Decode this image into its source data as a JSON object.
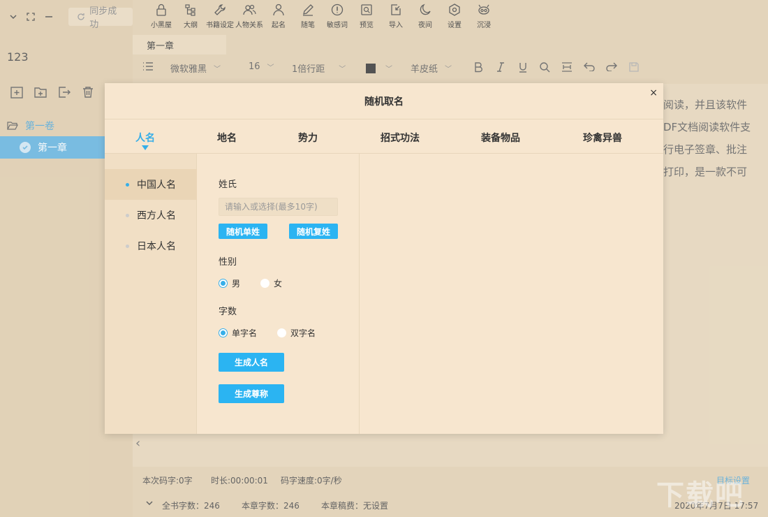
{
  "sidebar": {
    "sync_label": "同步成功",
    "count": "123",
    "volume": "第一卷",
    "chapter": "第一章"
  },
  "toolbar": {
    "items": [
      {
        "label": "小黑屋",
        "icon": "lock-icon"
      },
      {
        "label": "大纲",
        "icon": "outline-icon"
      },
      {
        "label": "书籍设定",
        "icon": "wrench-icon"
      },
      {
        "label": "人物关系",
        "icon": "people-icon"
      },
      {
        "label": "起名",
        "icon": "person-icon"
      },
      {
        "label": "随笔",
        "icon": "pen-icon"
      },
      {
        "label": "敏感词",
        "icon": "alert-icon"
      },
      {
        "label": "预览",
        "icon": "preview-icon"
      },
      {
        "label": "导入",
        "icon": "import-icon"
      },
      {
        "label": "夜间",
        "icon": "moon-icon"
      },
      {
        "label": "设置",
        "icon": "gear-icon"
      },
      {
        "label": "沉浸",
        "icon": "immerse-icon"
      }
    ]
  },
  "tab": {
    "chapter": "第一章"
  },
  "format": {
    "font": "微软雅黑",
    "size": "16",
    "line_height": "1倍行距",
    "paper": "羊皮纸"
  },
  "editor": {
    "lines": [
      "阅读，并且该软件",
      "DF文档阅读软件支",
      "行电子签章、批注",
      "打印，是一款不可"
    ]
  },
  "status": {
    "session_words": "本次码字:0字",
    "duration": "时长:00:00:01",
    "speed": "码字速度:0字/秒",
    "total_words": "全书字数：246",
    "chapter_words": "本章字数：246",
    "chapter_summary": "本章稿费：无设置",
    "datetime": "2020年7月7日 17:57",
    "goal_link": "目标设置"
  },
  "watermark": "下载吧",
  "dialog": {
    "title": "随机取名",
    "close": "×",
    "tabs": [
      "人名",
      "地名",
      "势力",
      "招式功法",
      "装备物品",
      "珍禽异兽"
    ],
    "categories": [
      "中国人名",
      "西方人名",
      "日本人名"
    ],
    "surname_label": "姓氏",
    "surname_placeholder": "请输入或选择(最多10字)",
    "btn_single_surname": "随机单姓",
    "btn_double_surname": "随机复姓",
    "gender_label": "性别",
    "gender_male": "男",
    "gender_female": "女",
    "length_label": "字数",
    "length_single": "单字名",
    "length_double": "双字名",
    "btn_generate_name": "生成人名",
    "btn_generate_title": "生成尊称"
  },
  "colors": {
    "accent": "#2bb4f2",
    "bg": "#e8d9bf",
    "dialog_bg": "#f7e6cf"
  }
}
